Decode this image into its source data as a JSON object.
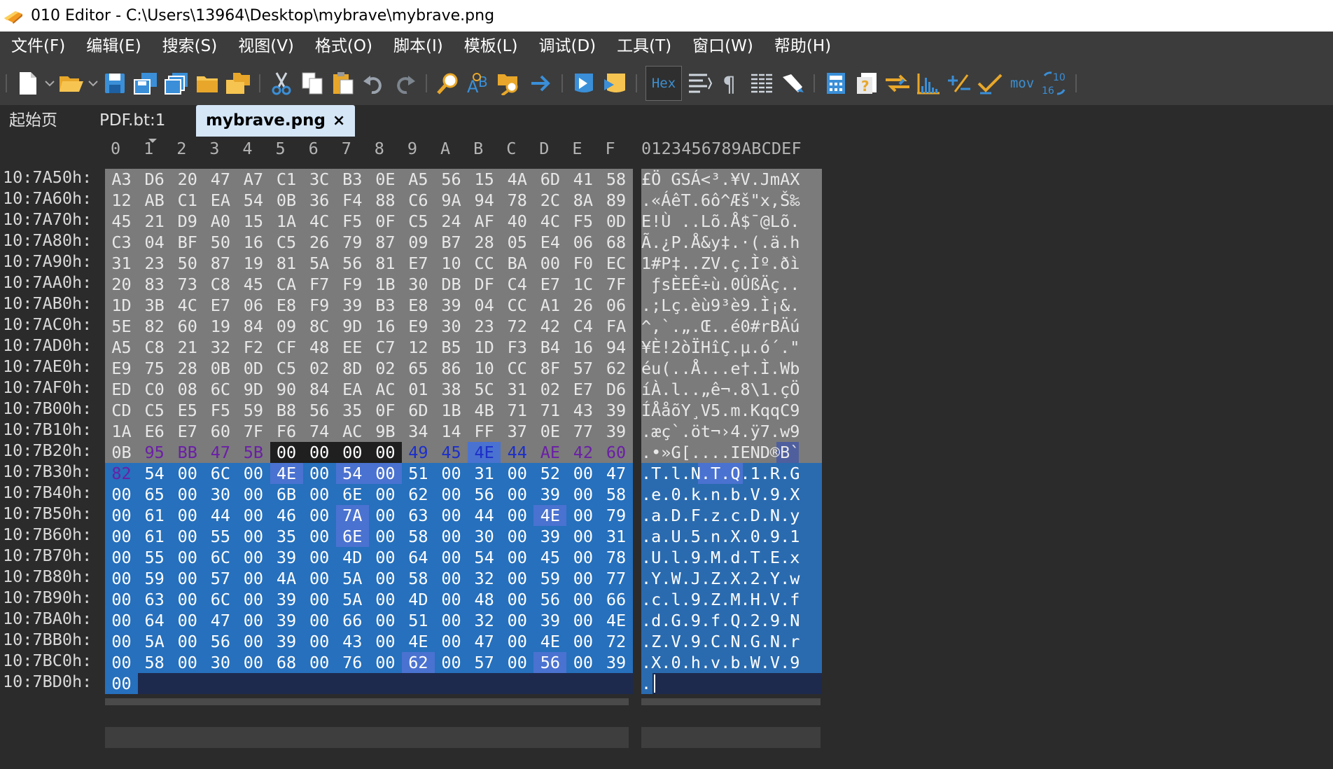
{
  "window": {
    "title": "010 Editor - C:\\Users\\13964\\Desktop\\mybrave\\mybrave.png"
  },
  "menu": [
    "文件(F)",
    "编辑(E)",
    "搜索(S)",
    "视图(V)",
    "格式(O)",
    "脚本(I)",
    "模板(L)",
    "调试(D)",
    "工具(T)",
    "窗口(W)",
    "帮助(H)"
  ],
  "toolbar": {
    "hex_label": "Hex",
    "mov_label": "mov",
    "base_label": "10/16",
    "buttons": [
      "new-file",
      "open-file",
      "save",
      "save-all",
      "save-copy",
      "open-folder",
      "workspace",
      "cut",
      "copy",
      "paste",
      "undo",
      "redo",
      "find",
      "replace",
      "find-in-files",
      "goto",
      "run-script",
      "run-template",
      "hex-mode",
      "text-mode",
      "show-whitespace",
      "columns",
      "highlight",
      "calculator",
      "inspector",
      "compare",
      "histogram",
      "checksum",
      "verify",
      "disassemble",
      "base-converter"
    ]
  },
  "tabs": [
    {
      "label": "起始页",
      "active": false
    },
    {
      "label": "PDF.bt:1",
      "active": false
    },
    {
      "label": "mybrave.png",
      "active": true,
      "close": "×"
    }
  ],
  "editor": {
    "column_header_hex": [
      "0",
      "1",
      "2",
      "3",
      "4",
      "5",
      "6",
      "7",
      "8",
      "9",
      "A",
      "B",
      "C",
      "D",
      "E",
      "F"
    ],
    "column_header_ascii": "0123456789ABCDEF",
    "rows": [
      {
        "addr": "10:7A50h:",
        "bytes": [
          "A3",
          "D6",
          "20",
          "47",
          "A7",
          "C1",
          "3C",
          "B3",
          "0E",
          "A5",
          "56",
          "15",
          "4A",
          "6D",
          "41",
          "58"
        ],
        "ascii": "£Ö GSÁ<³.¥V.JmAX"
      },
      {
        "addr": "10:7A60h:",
        "bytes": [
          "12",
          "AB",
          "C1",
          "EA",
          "54",
          "0B",
          "36",
          "F4",
          "88",
          "C6",
          "9A",
          "94",
          "78",
          "2C",
          "8A",
          "89"
        ],
        "ascii": ".«ÁêT.6ô^Æš\"x,Š‰"
      },
      {
        "addr": "10:7A70h:",
        "bytes": [
          "45",
          "21",
          "D9",
          "A0",
          "15",
          "1A",
          "4C",
          "F5",
          "0F",
          "C5",
          "24",
          "AF",
          "40",
          "4C",
          "F5",
          "0D"
        ],
        "ascii": "E!Ù ..Lõ.Å$¯@Lõ."
      },
      {
        "addr": "10:7A80h:",
        "bytes": [
          "C3",
          "04",
          "BF",
          "50",
          "16",
          "C5",
          "26",
          "79",
          "87",
          "09",
          "B7",
          "28",
          "05",
          "E4",
          "06",
          "68"
        ],
        "ascii": "Ã.¿P.Å&y‡.·(.ä.h"
      },
      {
        "addr": "10:7A90h:",
        "bytes": [
          "31",
          "23",
          "50",
          "87",
          "19",
          "81",
          "5A",
          "56",
          "81",
          "E7",
          "10",
          "CC",
          "BA",
          "00",
          "F0",
          "EC"
        ],
        "ascii": "1#P‡..ZV.ç.Ìº.ðì"
      },
      {
        "addr": "10:7AA0h:",
        "bytes": [
          "20",
          "83",
          "73",
          "C8",
          "45",
          "CA",
          "F7",
          "F9",
          "1B",
          "30",
          "DB",
          "DF",
          "C4",
          "E7",
          "1C",
          "7F"
        ],
        "ascii": " ƒsÈEÊ÷ù.0ÛßÄç.."
      },
      {
        "addr": "10:7AB0h:",
        "bytes": [
          "1D",
          "3B",
          "4C",
          "E7",
          "06",
          "E8",
          "F9",
          "39",
          "B3",
          "E8",
          "39",
          "04",
          "CC",
          "A1",
          "26",
          "06"
        ],
        "ascii": ".;Lç.èù9³è9.Ì¡&."
      },
      {
        "addr": "10:7AC0h:",
        "bytes": [
          "5E",
          "82",
          "60",
          "19",
          "84",
          "09",
          "8C",
          "9D",
          "16",
          "E9",
          "30",
          "23",
          "72",
          "42",
          "C4",
          "FA"
        ],
        "ascii": "^‚`.„.Œ..é0#rBÄú"
      },
      {
        "addr": "10:7AD0h:",
        "bytes": [
          "A5",
          "C8",
          "21",
          "32",
          "F2",
          "CF",
          "48",
          "EE",
          "C7",
          "12",
          "B5",
          "1D",
          "F3",
          "B4",
          "16",
          "94"
        ],
        "ascii": "¥È!2òÏHîÇ.µ.ó´.\""
      },
      {
        "addr": "10:7AE0h:",
        "bytes": [
          "E9",
          "75",
          "28",
          "0B",
          "0D",
          "C5",
          "02",
          "8D",
          "02",
          "65",
          "86",
          "10",
          "CC",
          "8F",
          "57",
          "62"
        ],
        "ascii": "éu(..Å...e†.Ì.Wb"
      },
      {
        "addr": "10:7AF0h:",
        "bytes": [
          "ED",
          "C0",
          "08",
          "6C",
          "9D",
          "90",
          "84",
          "EA",
          "AC",
          "01",
          "38",
          "5C",
          "31",
          "02",
          "E7",
          "D6"
        ],
        "ascii": "íÀ.l..„ê¬.8\\1.çÖ"
      },
      {
        "addr": "10:7B00h:",
        "bytes": [
          "CD",
          "C5",
          "E5",
          "F5",
          "59",
          "B8",
          "56",
          "35",
          "0F",
          "6D",
          "1B",
          "4B",
          "71",
          "71",
          "43",
          "39"
        ],
        "ascii": "ÍÅåõY¸V5.m.KqqC9"
      },
      {
        "addr": "10:7B10h:",
        "bytes": [
          "1A",
          "E6",
          "E7",
          "60",
          "7F",
          "F6",
          "74",
          "AC",
          "9B",
          "34",
          "14",
          "FF",
          "37",
          "0E",
          "77",
          "39"
        ],
        "ascii": ".æç`.öt¬›4.ÿ7.w9"
      },
      {
        "addr": "10:7B20h:",
        "bytes": [
          "0B",
          "95",
          "BB",
          "47",
          "5B",
          "00",
          "00",
          "00",
          "00",
          "49",
          "45",
          "4E",
          "44",
          "AE",
          "42",
          "60"
        ],
        "ascii": ".•»G[....IEND®B`"
      },
      {
        "addr": "10:7B30h:",
        "bytes": [
          "82",
          "54",
          "00",
          "6C",
          "00",
          "4E",
          "00",
          "54",
          "00",
          "51",
          "00",
          "31",
          "00",
          "52",
          "00",
          "47"
        ],
        "ascii": ".T.l.N.T.Q.1.R.G"
      },
      {
        "addr": "10:7B40h:",
        "bytes": [
          "00",
          "65",
          "00",
          "30",
          "00",
          "6B",
          "00",
          "6E",
          "00",
          "62",
          "00",
          "56",
          "00",
          "39",
          "00",
          "58"
        ],
        "ascii": ".e.0.k.n.b.V.9.X"
      },
      {
        "addr": "10:7B50h:",
        "bytes": [
          "00",
          "61",
          "00",
          "44",
          "00",
          "46",
          "00",
          "7A",
          "00",
          "63",
          "00",
          "44",
          "00",
          "4E",
          "00",
          "79"
        ],
        "ascii": ".a.D.F.z.c.D.N.y"
      },
      {
        "addr": "10:7B60h:",
        "bytes": [
          "00",
          "61",
          "00",
          "55",
          "00",
          "35",
          "00",
          "6E",
          "00",
          "58",
          "00",
          "30",
          "00",
          "39",
          "00",
          "31"
        ],
        "ascii": ".a.U.5.n.X.0.9.1"
      },
      {
        "addr": "10:7B70h:",
        "bytes": [
          "00",
          "55",
          "00",
          "6C",
          "00",
          "39",
          "00",
          "4D",
          "00",
          "64",
          "00",
          "54",
          "00",
          "45",
          "00",
          "78"
        ],
        "ascii": ".U.l.9.M.d.T.E.x"
      },
      {
        "addr": "10:7B80h:",
        "bytes": [
          "00",
          "59",
          "00",
          "57",
          "00",
          "4A",
          "00",
          "5A",
          "00",
          "58",
          "00",
          "32",
          "00",
          "59",
          "00",
          "77"
        ],
        "ascii": ".Y.W.J.Z.X.2.Y.w"
      },
      {
        "addr": "10:7B90h:",
        "bytes": [
          "00",
          "63",
          "00",
          "6C",
          "00",
          "39",
          "00",
          "5A",
          "00",
          "4D",
          "00",
          "48",
          "00",
          "56",
          "00",
          "66"
        ],
        "ascii": ".c.l.9.Z.M.H.V.f"
      },
      {
        "addr": "10:7BA0h:",
        "bytes": [
          "00",
          "64",
          "00",
          "47",
          "00",
          "39",
          "00",
          "66",
          "00",
          "51",
          "00",
          "32",
          "00",
          "39",
          "00",
          "4E"
        ],
        "ascii": ".d.G.9.f.Q.2.9.N"
      },
      {
        "addr": "10:7BB0h:",
        "bytes": [
          "00",
          "5A",
          "00",
          "56",
          "00",
          "39",
          "00",
          "43",
          "00",
          "4E",
          "00",
          "47",
          "00",
          "4E",
          "00",
          "72"
        ],
        "ascii": ".Z.V.9.C.N.G.N.r"
      },
      {
        "addr": "10:7BC0h:",
        "bytes": [
          "00",
          "58",
          "00",
          "30",
          "00",
          "68",
          "00",
          "76",
          "00",
          "62",
          "00",
          "57",
          "00",
          "56",
          "00",
          "39"
        ],
        "ascii": ".X.0.h.v.b.W.V.9"
      },
      {
        "addr": "10:7BD0h:",
        "bytes": [
          "00"
        ],
        "ascii": "."
      }
    ]
  },
  "colors": {
    "background": "#2b2b2b",
    "data_gray": "#7b7b7b",
    "selection_blue": "#2670bd",
    "ascii_blue": "#2a6bb0",
    "dark_navy": "#1e2a4d",
    "purple_text": "#6b1fa6",
    "highlight_4E": "#4a72d0",
    "iend_blue_text": "#1c2fc9"
  }
}
